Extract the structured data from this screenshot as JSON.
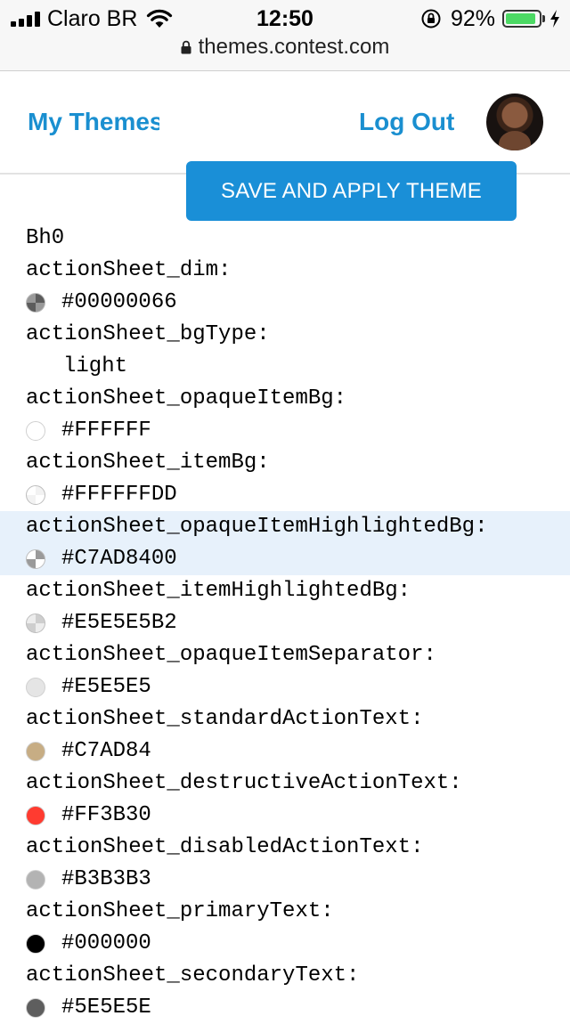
{
  "status": {
    "carrier": "Claro BR",
    "time": "12:50",
    "battery": "92%",
    "battery_level": 0.92,
    "url": "themes.contest.com"
  },
  "header": {
    "my_themes": "My Themes",
    "logout": "Log Out",
    "save_button": "SAVE AND APPLY THEME"
  },
  "theme": {
    "name": "Bh0",
    "entries": [
      {
        "key": "actionSheet_dim:",
        "value": "#00000066",
        "swatch": "#00000066",
        "icon": "checker-swatch-icon"
      },
      {
        "key": "actionSheet_bgType:",
        "value": "light"
      },
      {
        "key": "actionSheet_opaqueItemBg:",
        "value": "#FFFFFF",
        "swatch": "#FFFFFF",
        "icon": "color-swatch-icon"
      },
      {
        "key": "actionSheet_itemBg:",
        "value": "#FFFFFFDD",
        "swatch": "#FFFFFFDD",
        "icon": "checker-swatch-icon"
      },
      {
        "key": "actionSheet_opaqueItemHighlightedBg:",
        "value": "#C7AD8400",
        "swatch": "#C7AD8400",
        "icon": "checker-swatch-icon",
        "highlighted": true
      },
      {
        "key": "actionSheet_itemHighlightedBg:",
        "value": "#E5E5E5B2",
        "swatch": "#E5E5E5B2",
        "icon": "checker-swatch-icon"
      },
      {
        "key": "actionSheet_opaqueItemSeparator:",
        "value": "#E5E5E5",
        "swatch": "#E5E5E5",
        "icon": "color-swatch-icon"
      },
      {
        "key": "actionSheet_standardActionText:",
        "value": "#C7AD84",
        "swatch": "#C7AD84",
        "icon": "color-swatch-icon"
      },
      {
        "key": "actionSheet_destructiveActionText:",
        "value": "#FF3B30",
        "swatch": "#FF3B30",
        "icon": "color-swatch-icon"
      },
      {
        "key": "actionSheet_disabledActionText:",
        "value": "#B3B3B3",
        "swatch": "#B3B3B3",
        "icon": "color-swatch-icon"
      },
      {
        "key": "actionSheet_primaryText:",
        "value": "#000000",
        "swatch": "#000000",
        "icon": "color-swatch-icon"
      },
      {
        "key": "actionSheet_secondaryText:",
        "value": "#5E5E5E",
        "swatch": "#5E5E5E",
        "icon": "color-swatch-icon"
      }
    ]
  }
}
